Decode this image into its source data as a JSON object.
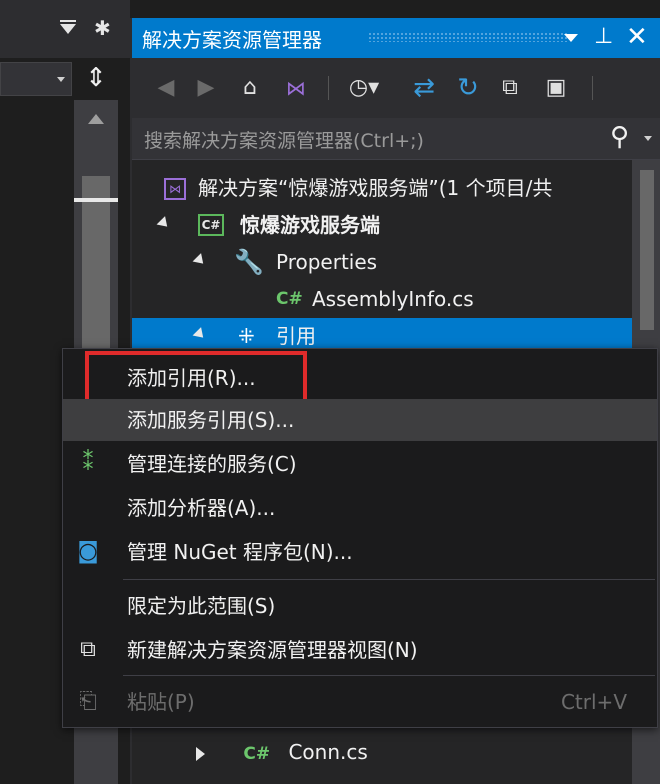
{
  "panel": {
    "title": "解决方案资源管理器",
    "search_placeholder": "搜索解决方案资源管理器(Ctrl+;)"
  },
  "icons": {
    "left_dropdown": "dropdown-icon",
    "left_settings": "gear-icon",
    "split": "split-icon",
    "back": "back-icon",
    "forward": "forward-icon",
    "home": "home-icon",
    "vs": "visual-studio-icon",
    "history": "history-icon",
    "sync": "sync-icon",
    "refresh": "refresh-icon",
    "collapse": "collapse-all-icon",
    "properties": "properties-icon",
    "search": "search-icon",
    "pin": "pin-icon",
    "close": "close-icon"
  },
  "tree": {
    "items": [
      {
        "label": "解决方案“惊爆游戏服务端”(1 个项目/共"
      },
      {
        "label": "惊爆游戏服务端",
        "icon_text": "C#"
      },
      {
        "label": "Properties"
      },
      {
        "label": "AssemblyInfo.cs",
        "icon_text": "C#"
      },
      {
        "label": "引用"
      },
      {
        "label": "Conn.cs",
        "icon_text": "C#"
      }
    ]
  },
  "context_menu": {
    "items": [
      {
        "label": "添加引用(R)..."
      },
      {
        "label": "添加服务引用(S)..."
      },
      {
        "label": "管理连接的服务(C)"
      },
      {
        "label": "添加分析器(A)..."
      },
      {
        "label": "管理 NuGet 程序包(N)..."
      },
      {
        "label": "限定为此范围(S)"
      },
      {
        "label": "新建解决方案资源管理器视图(N)"
      },
      {
        "label": "粘贴(P)",
        "shortcut": "Ctrl+V"
      }
    ]
  },
  "colors": {
    "accent": "#007acc",
    "highlight_box": "#e02b2b",
    "csharp": "#6cc66c"
  }
}
